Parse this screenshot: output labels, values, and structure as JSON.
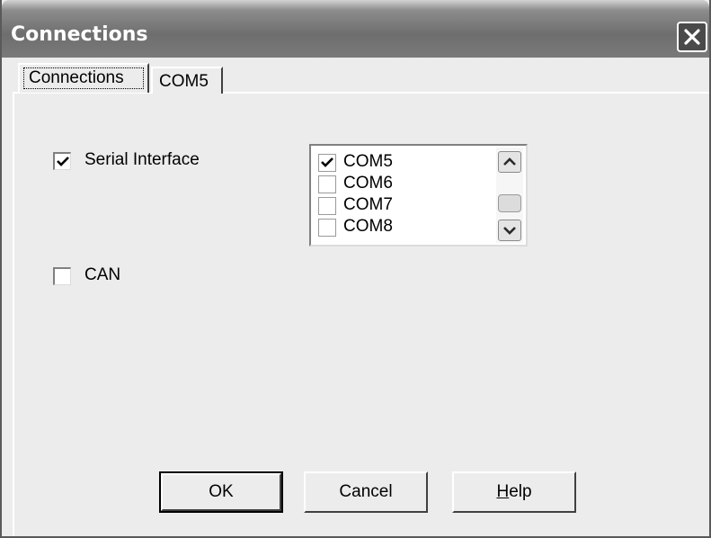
{
  "window": {
    "title": "Connections"
  },
  "tabs": [
    {
      "label": "Connections",
      "active": true
    },
    {
      "label": "COM5",
      "active": false
    }
  ],
  "options": {
    "serial_interface": {
      "label": "Serial Interface",
      "checked": true
    },
    "can": {
      "label": "CAN",
      "checked": false
    }
  },
  "ports": [
    {
      "label": "COM5",
      "checked": true
    },
    {
      "label": "COM6",
      "checked": false
    },
    {
      "label": "COM7",
      "checked": false
    },
    {
      "label": "COM8",
      "checked": false
    }
  ],
  "buttons": {
    "ok": "OK",
    "cancel": "Cancel",
    "help_mnemonic": "H",
    "help_rest": "elp"
  },
  "icons": {
    "close": "close-icon",
    "check": "checkmark-icon",
    "scroll_up": "chevron-up-icon",
    "scroll_down": "chevron-down-icon"
  }
}
